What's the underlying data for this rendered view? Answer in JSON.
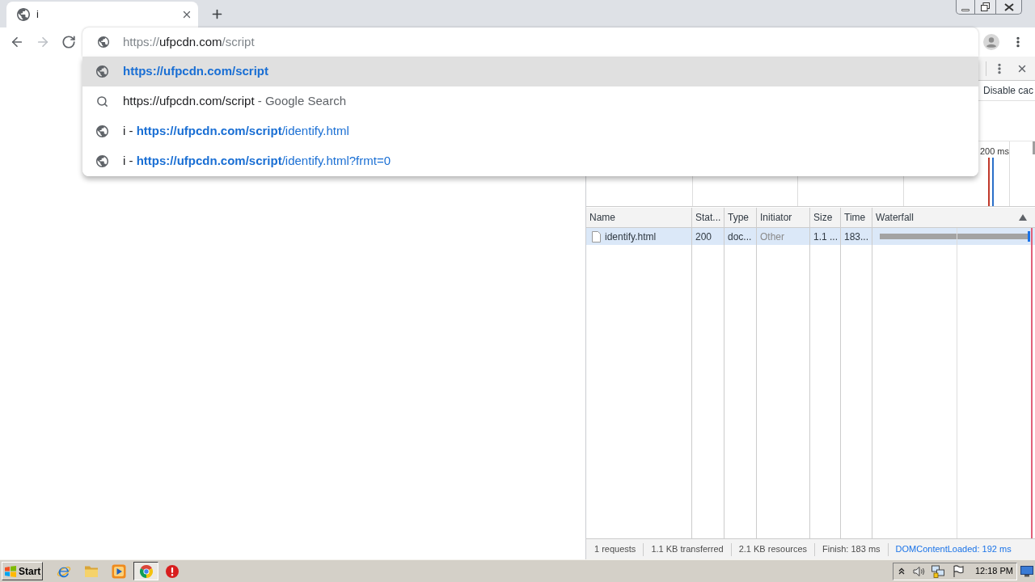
{
  "tabs": [
    {
      "title": "i",
      "selected": true
    }
  ],
  "navigation": [
    {
      "kind": "back",
      "disabled": false
    },
    {
      "kind": "forward",
      "disabled": true
    },
    {
      "kind": "reload",
      "disabled": false
    }
  ],
  "omnibox": {
    "scheme": "https://",
    "host": "ufpcdn.com",
    "path": "/script"
  },
  "suggestions": [
    {
      "kind": "url",
      "selected": true,
      "url": "https://ufpcdn.com/script"
    },
    {
      "kind": "search",
      "selected": false,
      "query": "https://ufpcdn.com/script",
      "description": "- Google Search"
    },
    {
      "kind": "history",
      "selected": false,
      "title": "i",
      "separator": "-",
      "url": "**https://ufpcdn.com/script**/identify.html"
    },
    {
      "kind": "history",
      "selected": false,
      "title": "i",
      "separator": "-",
      "url": "**https://ufpcdn.com/script**/identify.html?frmt=0"
    }
  ],
  "devtools": {
    "toolbar_label": "Disable cac",
    "overview_tick": "200 ms",
    "columns": [
      "Name",
      "Stat...",
      "Type",
      "Initiator",
      "Size",
      "Time",
      "Waterfall"
    ],
    "rows": [
      {
        "selected": true,
        "cells": [
          "identify.html",
          "200",
          "doc...",
          "Other",
          "1.1 ...",
          "183..."
        ]
      }
    ],
    "summary": [
      {
        "text": "1 requests",
        "color": "#4d4d4d"
      },
      {
        "text": "1.1 KB transferred",
        "color": "#4d4d4d"
      },
      {
        "text": "2.1 KB resources",
        "color": "#4d4d4d"
      },
      {
        "text": "Finish: 183 ms",
        "color": "#4d4d4d"
      },
      {
        "text": "DOMContentLoaded: 192 ms",
        "color": "#1a73e8"
      }
    ]
  },
  "taskbar": {
    "start": "Start",
    "apps": [
      {
        "kind": "browser",
        "active": false
      },
      {
        "kind": "folder",
        "active": false
      },
      {
        "kind": "player",
        "active": false
      },
      {
        "kind": "wheel",
        "active": true
      },
      {
        "kind": "alert",
        "active": false
      }
    ],
    "clock": "12:18 PM"
  }
}
